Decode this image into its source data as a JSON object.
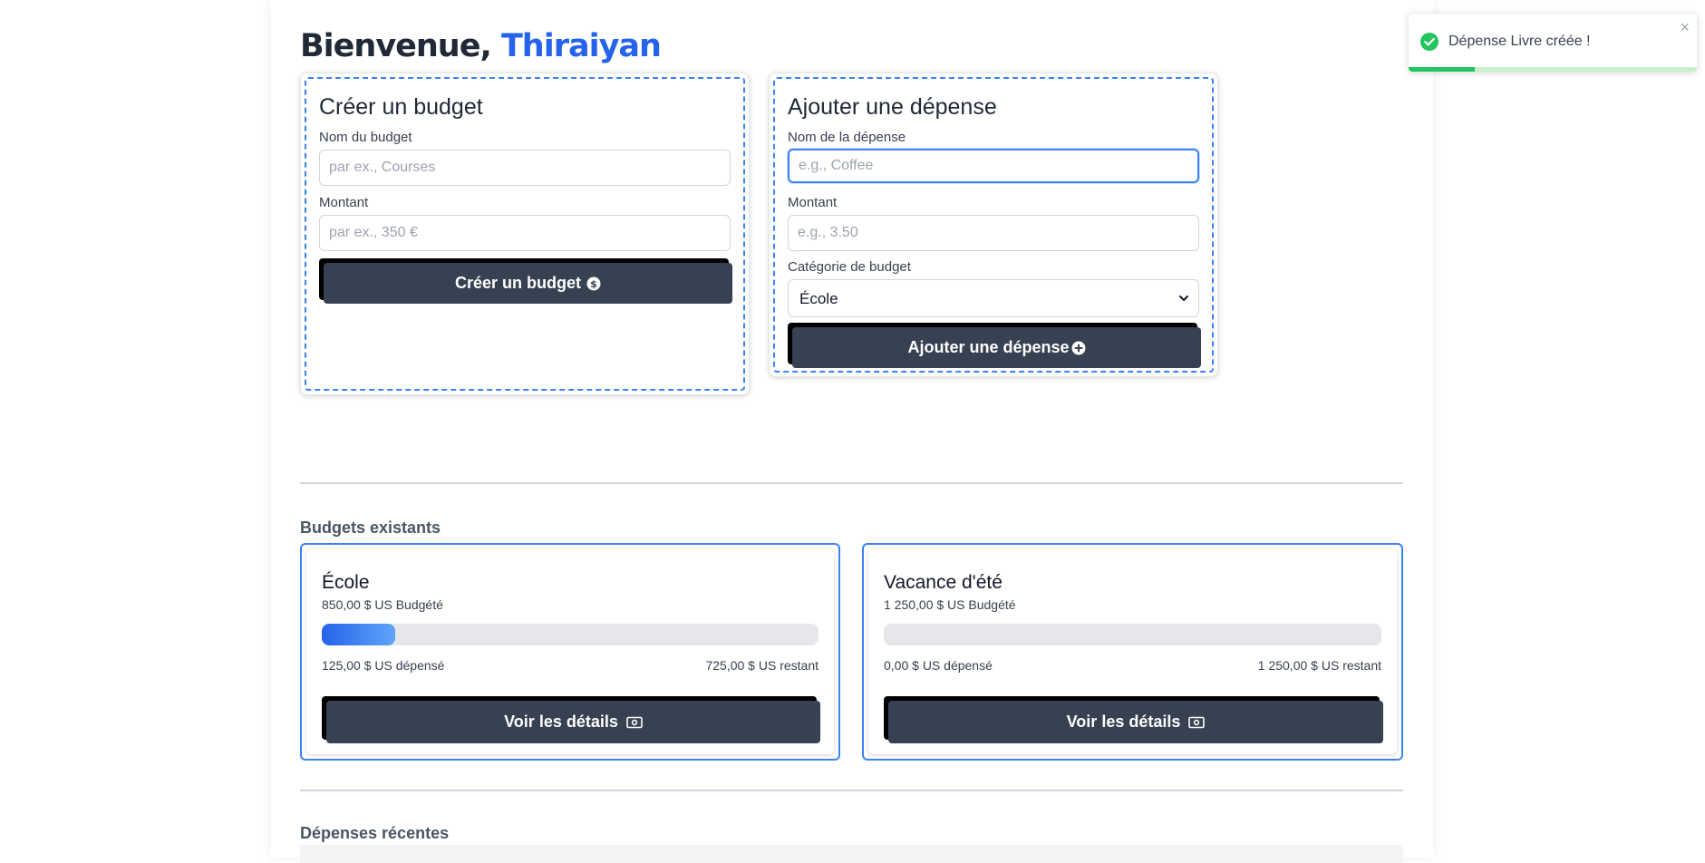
{
  "header": {
    "greeting": "Bienvenue,",
    "username": "Thiraiyan"
  },
  "create_budget": {
    "title": "Créer un budget",
    "name_label": "Nom du budget",
    "name_placeholder": "par ex., Courses",
    "amount_label": "Montant",
    "amount_placeholder": "par ex., 350 €",
    "button_label": "Créer un budget",
    "button_icon": "dollar-circle-icon"
  },
  "add_expense": {
    "title": "Ajouter une dépense",
    "name_label": "Nom de la dépense",
    "name_placeholder": "e.g., Coffee",
    "amount_label": "Montant",
    "amount_placeholder": "e.g., 3.50",
    "category_label": "Catégorie de budget",
    "category_selected": "École",
    "button_label": "Ajouter une dépense",
    "button_icon": "plus-circle-icon"
  },
  "budgets_section": {
    "title": "Budgets existants",
    "budgets": [
      {
        "name": "École",
        "budgeted": "850,00 $ US Budgété",
        "spent": "125,00 $ US dépensé",
        "remaining": "725,00 $ US restant",
        "progress_fraction": 0.147,
        "button_label": "Voir les détails"
      },
      {
        "name": "Vacance d'été",
        "budgeted": "1 250,00 $ US Budgété",
        "spent": "0,00 $ US dépensé",
        "remaining": "1 250,00 $ US restant",
        "progress_fraction": 0,
        "button_label": "Voir les détails"
      }
    ]
  },
  "recent_section": {
    "title": "Dépenses récentes"
  },
  "toast": {
    "message": "Dépense Livre créée !",
    "close_symbol": "×",
    "icon": "check-circle-icon",
    "progress_fraction": 0.23
  },
  "colors": {
    "accent": "#2563eb",
    "button": "#374151",
    "success": "#22c55e"
  }
}
